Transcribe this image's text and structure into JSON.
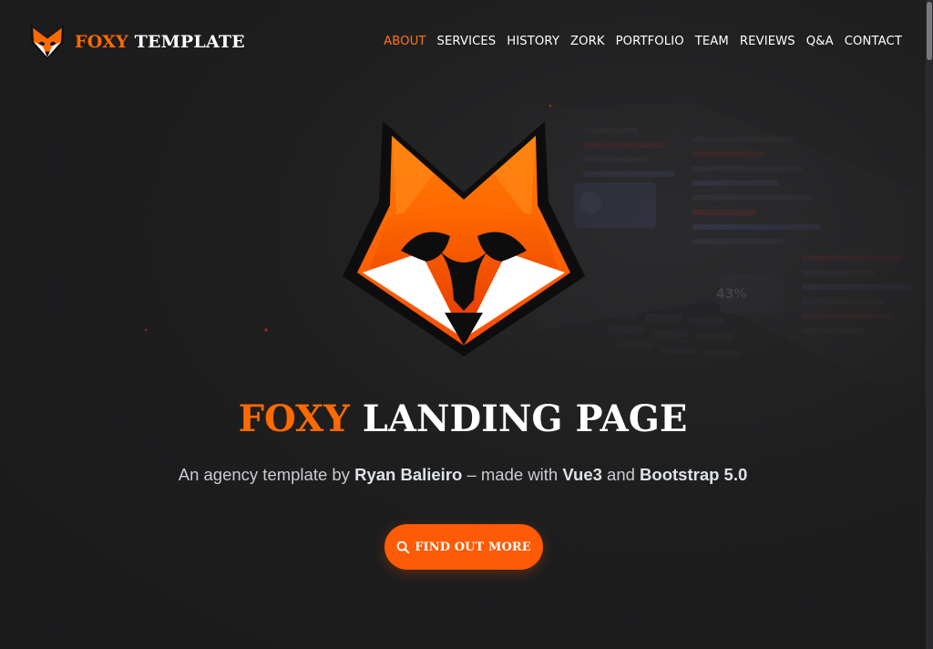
{
  "brand": {
    "name_accent": "FOXY",
    "name_rest": "TEMPLATE",
    "logo_icon": "fox-head-icon"
  },
  "nav": {
    "items": [
      {
        "label": "ABOUT",
        "active": true
      },
      {
        "label": "SERVICES",
        "active": false
      },
      {
        "label": "HISTORY",
        "active": false
      },
      {
        "label": "ZORK",
        "active": false
      },
      {
        "label": "PORTFOLIO",
        "active": false
      },
      {
        "label": "TEAM",
        "active": false
      },
      {
        "label": "REVIEWS",
        "active": false
      },
      {
        "label": "Q&A",
        "active": false
      },
      {
        "label": "CONTACT",
        "active": false
      }
    ]
  },
  "hero": {
    "background_readout": "43%",
    "title_accent": "FOXY",
    "title_rest": "LANDING PAGE",
    "subtitle": {
      "p1": "An agency template by ",
      "author": "Ryan Balieiro",
      "p2": " – made with ",
      "tech1": "Vue3",
      "p3": " and ",
      "tech2": "Bootstrap 5.0"
    },
    "cta_label": "FIND OUT MORE",
    "cta_icon": "search-icon"
  },
  "colors": {
    "accent": "#ff6a00",
    "button": "#ff5a05",
    "background": "#1c1c1d",
    "text": "#ffffff",
    "subtitle_text": "#c9ccd0"
  }
}
